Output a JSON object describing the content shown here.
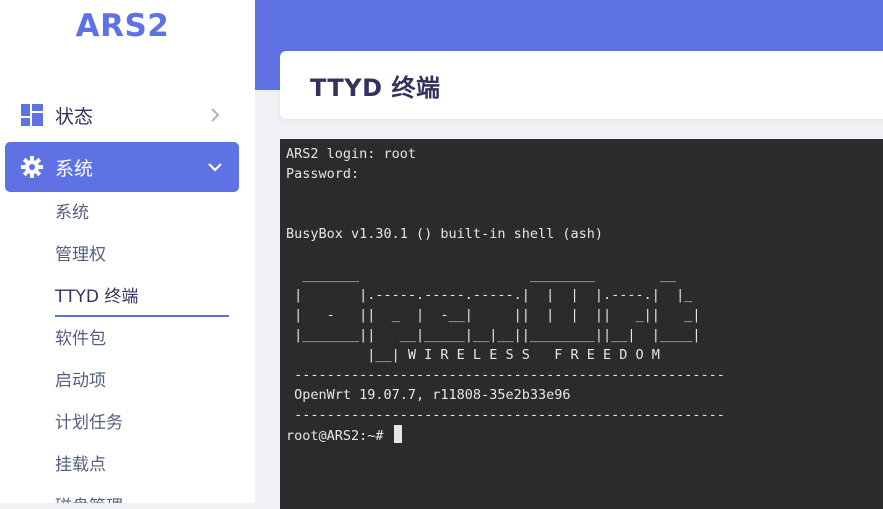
{
  "brand": "ARS2",
  "page_title": "TTYD 终端",
  "sidebar": {
    "status_label": "状态",
    "system_label": "系统",
    "sub_items": [
      "系统",
      "管理权",
      "TTYD 终端",
      "软件包",
      "启动项",
      "计划任务",
      "挂载点",
      "磁盘管理"
    ],
    "current_sub": "TTYD 终端"
  },
  "terminal": {
    "lines": [
      "ARS2 login: root",
      "Password:",
      "",
      "",
      "BusyBox v1.30.1 () built-in shell (ash)",
      "",
      "  _______                     ________        __",
      " |       |.-----.-----.-----.|  |  |  |.----.|  |_",
      " |   -   ||  _  |  -__|     ||  |  |  ||   _||   _|",
      " |_______||   __|_____|__|__||________||__|  |____|",
      "          |__| W I R E L E S S   F R E E D O M",
      " -----------------------------------------------------",
      " OpenWrt 19.07.7, r11808-35e2b33e96",
      " -----------------------------------------------------",
      "root@ARS2:~# "
    ]
  },
  "colors": {
    "accent": "#5e72e4",
    "terminal_bg": "#2b2b2b",
    "text_dark": "#32325d"
  },
  "icons": {
    "status": "dashboard-grid-icon",
    "system": "gear-icon",
    "collapsed": "chevron-right-icon",
    "expanded": "chevron-down-icon"
  }
}
